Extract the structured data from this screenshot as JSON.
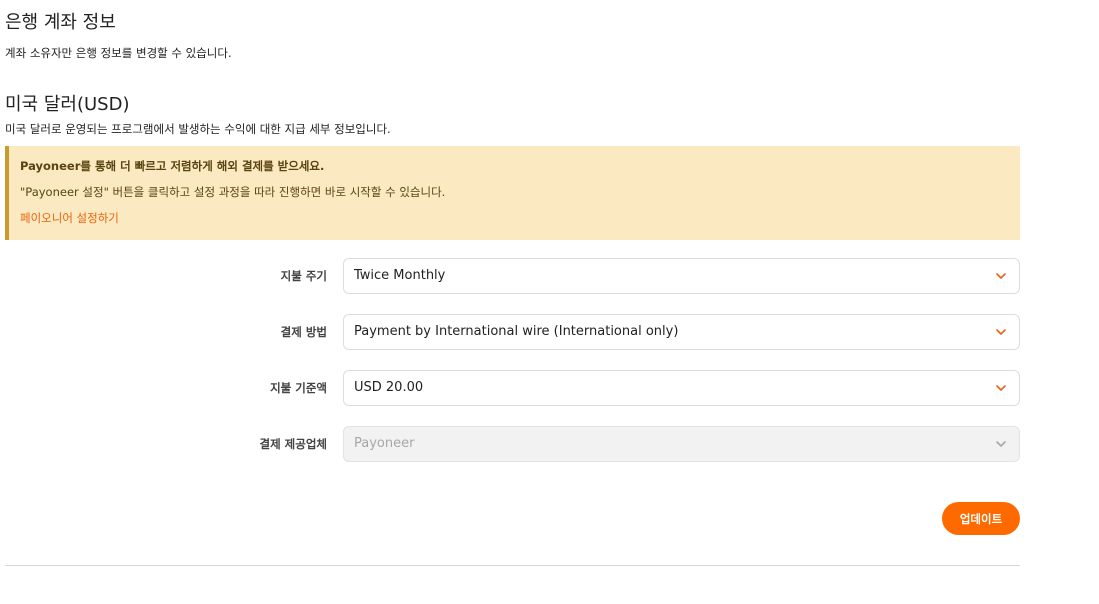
{
  "bank_section": {
    "title": "은행 계좌 정보",
    "description": "계좌 소유자만 은행 정보를 변경할 수 있습니다."
  },
  "currency_section": {
    "title": "미국 달러(USD)",
    "description": "미국 달러로 운영되는 프로그램에서 발생하는 수익에 대한 지급 세부 정보입니다."
  },
  "notice": {
    "title": "Payoneer를 통해 더 빠르고 저렴하게 해외 결제를 받으세요.",
    "body": "\"Payoneer 설정\" 버튼을 클릭하고 설정 과정을 따라 진행하면 바로 시작할 수 있습니다.",
    "link": "페이오니어 설정하기",
    "colors": {
      "background": "#fae9c1",
      "border": "#c99a2e",
      "link": "#e8650e"
    }
  },
  "form": {
    "payment_frequency": {
      "label": "지불 주기",
      "value": "Twice Monthly"
    },
    "payment_method": {
      "label": "결제 방법",
      "value": "Payment by International wire (International only)"
    },
    "payment_threshold": {
      "label": "지불 기준액",
      "value": "USD 20.00"
    },
    "payment_provider": {
      "label": "결제 제공업체",
      "value": "Payoneer",
      "disabled": true
    }
  },
  "actions": {
    "update_label": "업데이트",
    "accent": "#ff6a00"
  },
  "icons": {
    "select_chevron": "chevron-down-icon"
  }
}
